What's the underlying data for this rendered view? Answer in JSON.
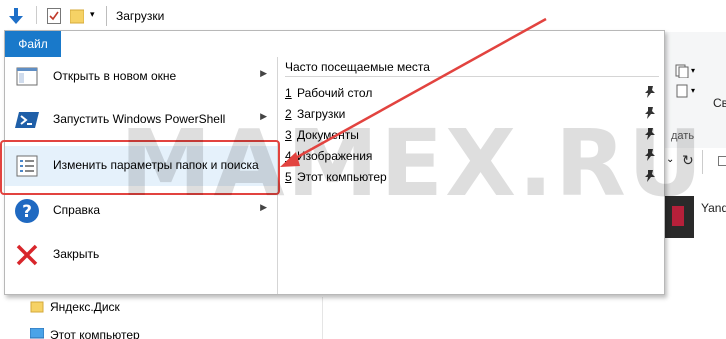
{
  "titlebar": {
    "title": "Загрузки"
  },
  "file_tab": {
    "label": "Файл"
  },
  "menu": {
    "items": [
      {
        "label": "Открыть в новом окне",
        "icon": "new-window-icon",
        "has_submenu": true
      },
      {
        "label": "Запустить Windows PowerShell",
        "icon": "powershell-icon",
        "has_submenu": true
      },
      {
        "label": "Изменить параметры папок и поиска",
        "icon": "folder-options-icon",
        "has_submenu": false
      },
      {
        "label": "Справка",
        "icon": "help-icon",
        "has_submenu": true
      },
      {
        "label": "Закрыть",
        "icon": "close-icon",
        "has_submenu": false
      }
    ]
  },
  "recent": {
    "header": "Часто посещаемые места",
    "items": [
      {
        "num": "1",
        "label": "Рабочий стол"
      },
      {
        "num": "2",
        "label": "Загрузки"
      },
      {
        "num": "3",
        "label": "Документы"
      },
      {
        "num": "4",
        "label": "Изображения"
      },
      {
        "num": "5",
        "label": "Этот компьютер"
      }
    ]
  },
  "background": {
    "ribbon_text_1": "Св",
    "ribbon_text_2": "дать",
    "file_label": "Yand",
    "nav_items": [
      "Яндекс.Диск",
      "Этот компьютер"
    ]
  },
  "watermark": "MAMEX.RU",
  "colors": {
    "file_tab_bg": "#1979ca",
    "highlight": "#e2433f",
    "hover_bg": "#e5f1fb",
    "arrow": "#e2433f"
  }
}
